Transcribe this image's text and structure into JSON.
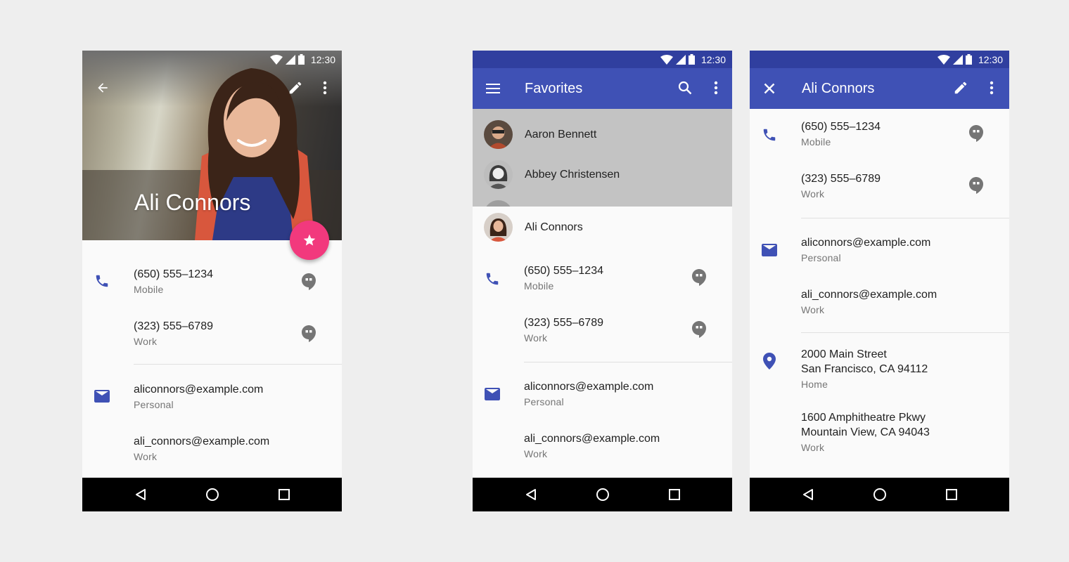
{
  "colors": {
    "primary": "#3f51b5",
    "primary_dark": "#303f9f",
    "accent": "#f2397d",
    "icon_blue": "#3f51b5",
    "hangouts_grey": "#757575"
  },
  "status_bar": {
    "time": "12:30",
    "icons": [
      "wifi-icon",
      "signal-icon",
      "battery-icon"
    ]
  },
  "nav_bar": {
    "buttons": [
      "back-triangle-icon",
      "home-circle-icon",
      "recents-square-icon"
    ]
  },
  "phone1": {
    "header_name": "Ali Connors",
    "header_actions": [
      "back-arrow-icon",
      "edit-pencil-icon",
      "more-vert-icon"
    ],
    "fab_icon": "star-icon",
    "phones": [
      {
        "number": "(650) 555–1234",
        "label": "Mobile",
        "action_icon": "hangouts-icon"
      },
      {
        "number": "(323) 555–6789",
        "label": "Work",
        "action_icon": "hangouts-icon"
      }
    ],
    "emails": [
      {
        "address": "aliconnors@example.com",
        "label": "Personal"
      },
      {
        "address": "ali_connors@example.com",
        "label": "Work"
      }
    ]
  },
  "phone2": {
    "appbar_title": "Favorites",
    "appbar_actions": [
      "menu-icon",
      "search-icon",
      "more-vert-icon"
    ],
    "favorites": [
      {
        "name": "Aaron Bennett"
      },
      {
        "name": "Abbey Christensen"
      }
    ],
    "selected_contact": "Ali Connors",
    "phones": [
      {
        "number": "(650) 555–1234",
        "label": "Mobile",
        "action_icon": "hangouts-icon"
      },
      {
        "number": "(323) 555–6789",
        "label": "Work",
        "action_icon": "hangouts-icon"
      }
    ],
    "emails": [
      {
        "address": "aliconnors@example.com",
        "label": "Personal"
      },
      {
        "address": "ali_connors@example.com",
        "label": "Work"
      }
    ]
  },
  "phone3": {
    "appbar_title": "Ali Connors",
    "appbar_actions": [
      "close-icon",
      "edit-pencil-icon",
      "more-vert-icon"
    ],
    "phones": [
      {
        "number": "(650) 555–1234",
        "label": "Mobile",
        "action_icon": "hangouts-icon"
      },
      {
        "number": "(323) 555–6789",
        "label": "Work",
        "action_icon": "hangouts-icon"
      }
    ],
    "emails": [
      {
        "address": "aliconnors@example.com",
        "label": "Personal"
      },
      {
        "address": "ali_connors@example.com",
        "label": "Work"
      }
    ],
    "addresses": [
      {
        "line1": "2000 Main Street",
        "line2": "San Francisco, CA 94112",
        "label": "Home"
      },
      {
        "line1": "1600 Amphitheatre Pkwy",
        "line2": "Mountain View, CA 94043",
        "label": "Work"
      }
    ]
  }
}
